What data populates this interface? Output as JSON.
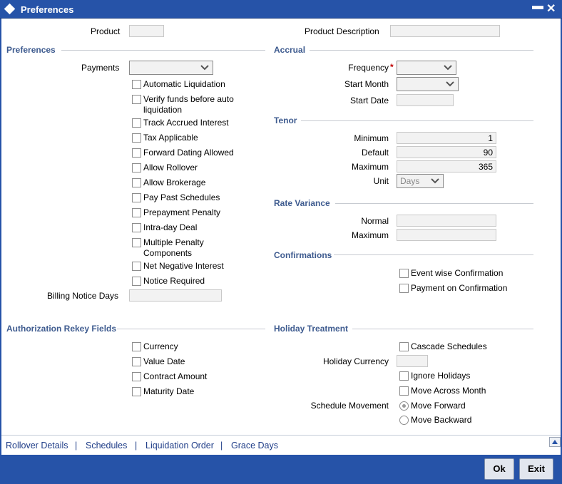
{
  "window": {
    "title": "Preferences",
    "minimize": "▬",
    "close": "✕"
  },
  "header": {
    "product_label": "Product",
    "product_value": "",
    "product_desc_label": "Product Description",
    "product_desc_value": ""
  },
  "preferences": {
    "section_title": "Preferences",
    "payments_label": "Payments",
    "payments_value": "",
    "options": [
      "Automatic Liquidation",
      "Verify funds before auto liquidation",
      "Track Accrued Interest",
      "Tax Applicable",
      "Forward Dating Allowed",
      "Allow Rollover",
      "Allow Brokerage",
      "Pay Past Schedules",
      "Prepayment Penalty",
      "Intra-day Deal",
      "Multiple Penalty Components",
      "Net Negative Interest",
      "Notice Required"
    ],
    "billing_notice_label": "Billing Notice Days",
    "billing_notice_value": ""
  },
  "accrual": {
    "section_title": "Accrual",
    "frequency_label": "Frequency",
    "required_mark": "*",
    "frequency_value": "",
    "start_month_label": "Start Month",
    "start_month_value": "",
    "start_date_label": "Start Date",
    "start_date_value": ""
  },
  "tenor": {
    "section_title": "Tenor",
    "minimum_label": "Minimum",
    "minimum_value": "1",
    "default_label": "Default",
    "default_value": "90",
    "maximum_label": "Maximum",
    "maximum_value": "365",
    "unit_label": "Unit",
    "unit_value": "Days"
  },
  "rate_variance": {
    "section_title": "Rate Variance",
    "normal_label": "Normal",
    "normal_value": "",
    "maximum_label": "Maximum",
    "maximum_value": ""
  },
  "confirmations": {
    "section_title": "Confirmations",
    "event_wise": "Event wise Confirmation",
    "payment_on": "Payment on Confirmation"
  },
  "auth_rekey": {
    "section_title": "Authorization Rekey Fields",
    "fields": [
      "Currency",
      "Value Date",
      "Contract Amount",
      "Maturity Date"
    ]
  },
  "holiday": {
    "section_title": "Holiday Treatment",
    "cascade": "Cascade Schedules",
    "currency_label": "Holiday Currency",
    "currency_value": "",
    "ignore": "Ignore Holidays",
    "move_across": "Move Across Month",
    "schedule_movement_label": "Schedule Movement",
    "move_forward": "Move Forward",
    "move_backward": "Move Backward"
  },
  "links": [
    "Rollover Details",
    "Schedules",
    "Liquidation Order",
    "Grace Days"
  ],
  "link_separator": "|",
  "buttons": {
    "ok": "Ok",
    "exit": "Exit"
  },
  "colors": {
    "title_bar": "#2653a8",
    "section_title": "#3e5b8f",
    "link": "#1f3d88",
    "required": "#c00000"
  }
}
